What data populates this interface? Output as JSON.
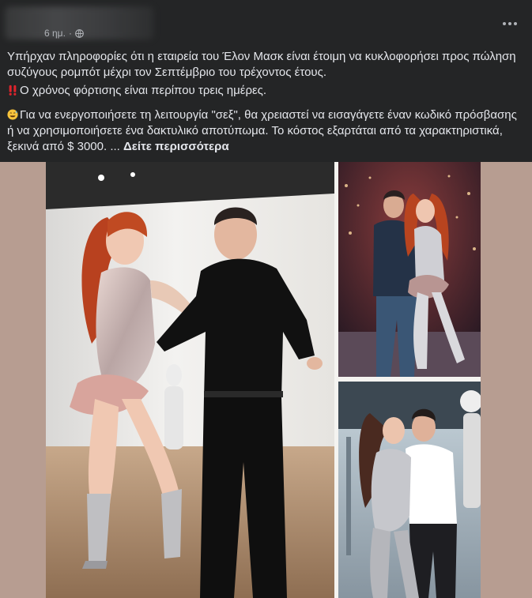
{
  "post": {
    "timestamp": "6 ημ.",
    "separator": "·",
    "privacy_icon": "globe-icon",
    "menu_icon": "more-options-icon",
    "paragraph1": "Υπήρχαν πληροφορίες ότι η εταιρεία του Έλον Μασκ είναι έτοιμη να κυκλοφορήσει προς πώληση συζύγους ρομπότ μέχρι τον Σεπτέμβριο του τρέχοντος έτους.",
    "paragraph2_emoji": "double-exclamation-icon",
    "paragraph2": "Ο χρόνος φόρτισης είναι περίπου τρεις ημέρες.",
    "paragraph3_emoji": "grinning-sweat-face-icon",
    "paragraph3": "Για να ενεργοποιήσετε τη λειτουργία \"σεξ\", θα χρειαστεί να εισαγάγετε έναν κωδικό πρόσβασης ή να χρησιμοποιήσετε ένα δακτυλικό αποτύπωμα. Το κόστος εξαρτάται από τα χαρακτηριστικά, ξεκινά από $ 3000. ...",
    "see_more": "Δείτε περισσότερα"
  },
  "colors": {
    "background": "#242526",
    "text": "#e4e6eb",
    "secondary_text": "#b0b3b8",
    "media_backdrop": "#b79d91"
  }
}
